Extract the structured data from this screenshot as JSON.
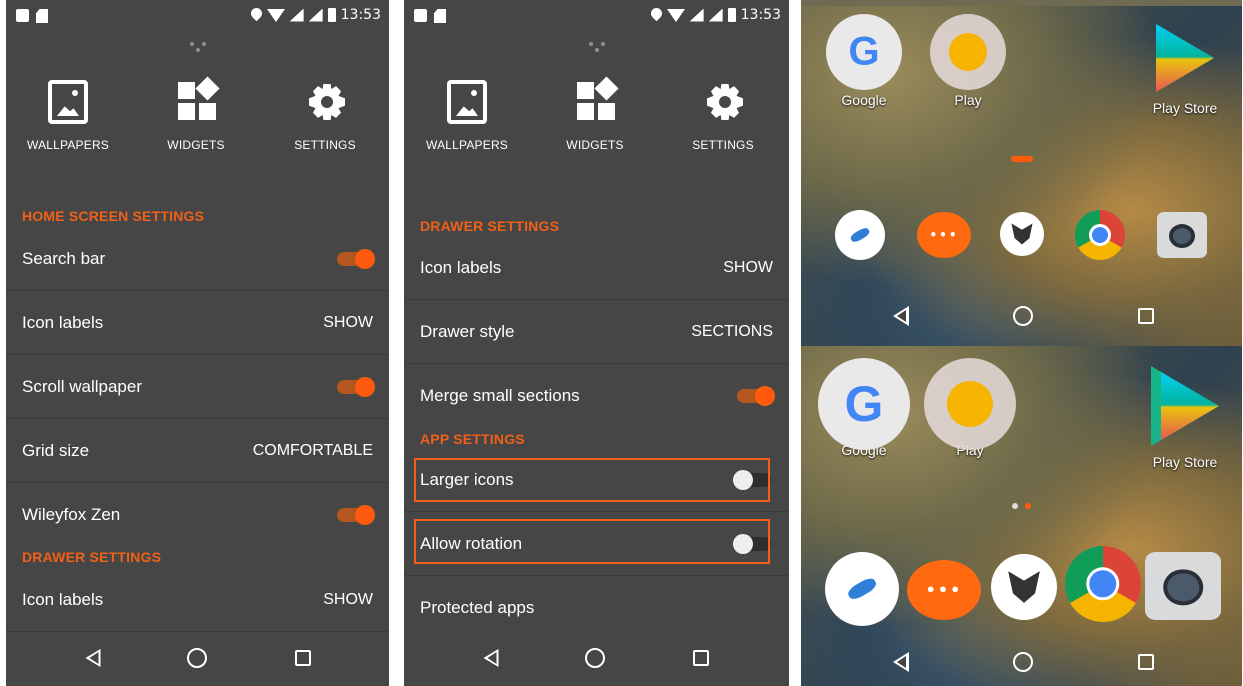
{
  "status": {
    "time": "13:53"
  },
  "shortcuts": {
    "wallpapers": "WALLPAPERS",
    "widgets": "WIDGETS",
    "settings": "SETTINGS"
  },
  "panel1": {
    "home_section": "HOME SCREEN SETTINGS",
    "rows": [
      {
        "label": "Search bar",
        "toggle": "on"
      },
      {
        "label": "Icon labels",
        "value": "SHOW"
      },
      {
        "label": "Scroll wallpaper",
        "toggle": "on"
      },
      {
        "label": "Grid size",
        "value": "COMFORTABLE"
      },
      {
        "label": "Wileyfox Zen",
        "toggle": "on"
      }
    ],
    "drawer_section": "DRAWER SETTINGS",
    "drawer_rows": [
      {
        "label": "Icon labels",
        "value": "SHOW"
      }
    ]
  },
  "panel2": {
    "drawer_section": "DRAWER SETTINGS",
    "drawer_rows": [
      {
        "label": "Icon labels",
        "value": "SHOW"
      },
      {
        "label": "Drawer style",
        "value": "SECTIONS"
      },
      {
        "label": "Merge small sections",
        "toggle": "on"
      }
    ],
    "app_section": "APP SETTINGS",
    "app_rows": [
      {
        "label": "Larger icons",
        "toggle": "off"
      },
      {
        "label": "Allow rotation",
        "toggle": "off"
      },
      {
        "label": "Protected apps"
      }
    ]
  },
  "homescreen": {
    "apps": [
      {
        "label": "Google",
        "icon": "google-icon"
      },
      {
        "label": "Play",
        "icon": "play-music-icon"
      },
      {
        "label": "Play Store",
        "icon": "play-store-icon"
      }
    ],
    "dock": [
      "phone-icon",
      "messaging-icon",
      "wileyfox-icon",
      "chrome-icon",
      "camera-icon"
    ],
    "message_glyph": "•••",
    "google_glyph": "G"
  },
  "colors": {
    "accent": "#f06018",
    "panel_bg": "#464646"
  }
}
